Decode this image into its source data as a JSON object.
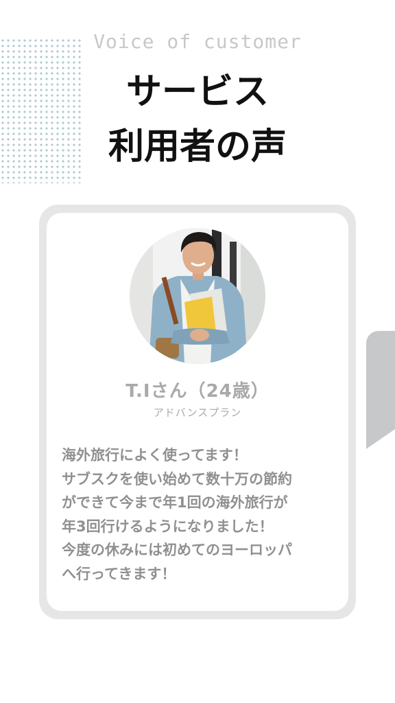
{
  "header": {
    "eyebrow": "Voice of customer",
    "title_line1": "サービス",
    "title_line2": "利用者の声"
  },
  "testimonial": {
    "avatar_icon": "smiling-student-photo",
    "name": "T.Iさん（24歳）",
    "plan": "アドバンスプラン",
    "review_lines": [
      "海外旅行によく使ってます！",
      "サブスクを使い始めて数十万の節約",
      "ができて今まで年1回の海外旅行が",
      "年3回行けるようになりました！",
      "今度の休みには初めてのヨーロッパ",
      "へ行ってきます！"
    ]
  },
  "colors": {
    "card_border": "#e6e6e6",
    "muted_text": "#a8a9aa",
    "dot_pattern": "#a9c7cd",
    "side_tab": "#c6c8ca"
  }
}
